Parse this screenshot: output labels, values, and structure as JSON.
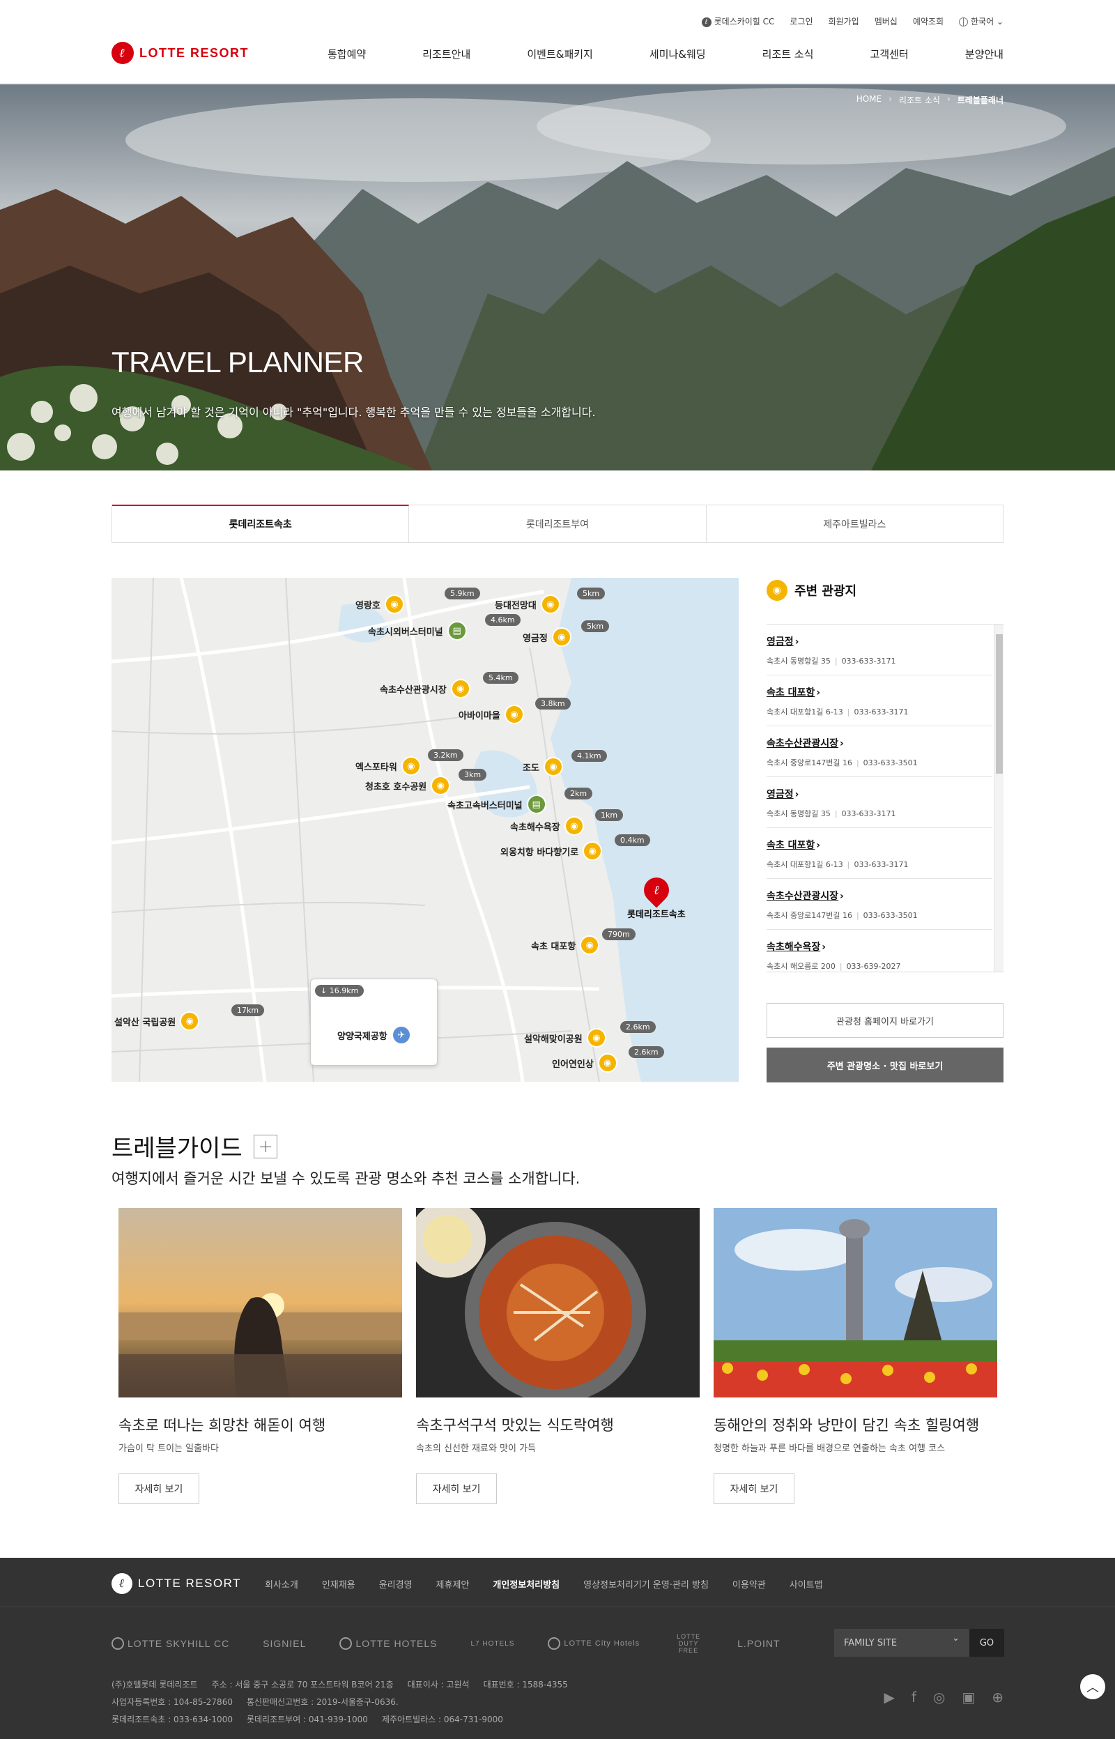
{
  "header": {
    "logo_text": "LOTTE RESORT",
    "util": {
      "skyhill": "롯데스카이힐 CC",
      "login": "로그인",
      "join": "회원가입",
      "membership": "멤버십",
      "reservation": "예약조회",
      "language": "한국어"
    },
    "nav": [
      "통합예약",
      "리조트안내",
      "이벤트&패키지",
      "세미나&웨딩",
      "리조트 소식",
      "고객센터",
      "분양안내"
    ]
  },
  "hero": {
    "breadcrumb": [
      "HOME",
      "리조트 소식",
      "트레블플래너"
    ],
    "title": "TRAVEL PLANNER",
    "subtitle": "여행에서 남겨야 할 것은 기억이 아니라 \"추억\"입니다. 행복한 추억을 만들 수 있는 정보들을 소개합니다."
  },
  "tabs": [
    "롯데리조트속초",
    "롯데리조트부여",
    "제주아트빌라스"
  ],
  "map": {
    "resort_label": "롯데리조트속초",
    "pois": [
      {
        "name": "영랑호",
        "dist": "5.9km",
        "type": "camera"
      },
      {
        "name": "등대전망대",
        "dist": "5km",
        "type": "camera"
      },
      {
        "name": "속초시외버스터미널",
        "dist": "4.6km",
        "type": "bus"
      },
      {
        "name": "영금정",
        "dist": "5km",
        "type": "camera"
      },
      {
        "name": "속초수산관광시장",
        "dist": "5.4km",
        "type": "camera"
      },
      {
        "name": "아바이마을",
        "dist": "3.8km",
        "type": "camera"
      },
      {
        "name": "엑스포타워",
        "dist": "3.2km",
        "type": "camera"
      },
      {
        "name": "조도",
        "dist": "4.1km",
        "type": "camera"
      },
      {
        "name": "청초호 호수공원",
        "dist": "3km",
        "type": "camera"
      },
      {
        "name": "속초고속버스터미널",
        "dist": "2km",
        "type": "bus"
      },
      {
        "name": "속초해수욕장",
        "dist": "1km",
        "type": "camera"
      },
      {
        "name": "외옹치항 바다향기로",
        "dist": "0.4km",
        "type": "camera"
      },
      {
        "name": "속초 대포항",
        "dist": "790m",
        "type": "camera"
      },
      {
        "name": "설악산 국립공원",
        "dist": "17km",
        "type": "camera"
      },
      {
        "name": "양양국제공항",
        "dist": "↓ 16.9km",
        "type": "airport"
      },
      {
        "name": "설악해맞이공원",
        "dist": "2.6km",
        "type": "camera"
      },
      {
        "name": "인어연인상",
        "dist": "2.6km",
        "type": "camera"
      }
    ]
  },
  "side": {
    "title": "주변 관광지",
    "items": [
      {
        "name": "영금정",
        "addr": "속초시 동명항길 35",
        "tel": "033-633-3171"
      },
      {
        "name": "속초 대포항",
        "addr": "속초시 대포항1길 6-13",
        "tel": "033-633-3171"
      },
      {
        "name": "속초수산관광시장",
        "addr": "속초시 중앙로147번길 16",
        "tel": "033-633-3501"
      },
      {
        "name": "영금정",
        "addr": "속초시 동명항길 35",
        "tel": "033-633-3171"
      },
      {
        "name": "속초 대포항",
        "addr": "속초시 대포항1길 6-13",
        "tel": "033-633-3171"
      },
      {
        "name": "속초수산관광시장",
        "addr": "속초시 중앙로147번길 16",
        "tel": "033-633-3501"
      },
      {
        "name": "속초해수욕장",
        "addr": "속초시 해오름로 200",
        "tel": "033-639-2027"
      }
    ],
    "btn_tourism": "관광청 홈페이지 바로가기",
    "btn_nearby": "주변 관광명소 · 맛집 바로보기"
  },
  "guide": {
    "title": "트레블가이드",
    "subtitle": "여행지에서 즐거운 시간 보낼 수 있도록 관광 명소와 추천 코스를 소개합니다.",
    "cards": [
      {
        "title": "속초로 떠나는 희망찬 해돋이 여행",
        "desc": "가슴이 탁 트이는 일출바다",
        "btn": "자세히 보기"
      },
      {
        "title": "속초구석구석 맛있는 식도락여행",
        "desc": "속초의 신선한 재료와 맛이 가득",
        "btn": "자세히 보기"
      },
      {
        "title": "동해안의 정취와 낭만이 담긴 속초 힐링여행",
        "desc": "청명한 하늘과 푸른 바다를 배경으로 연출하는 속초 여행 코스",
        "btn": "자세히 보기"
      }
    ]
  },
  "footer": {
    "logo_text": "LOTTE RESORT",
    "nav": [
      "회사소개",
      "인재채용",
      "윤리경영",
      "제휴제안",
      "개인정보처리방침",
      "영상정보처리기기 운영·관리 방침",
      "이용약관",
      "사이트맵"
    ],
    "brands": [
      "LOTTE SKYHILL CC",
      "SIGNIEL",
      "LOTTE HOTELS",
      "L7 HOTELS",
      "LOTTE City Hotels",
      "LOTTE DUTY FREE",
      "L.POINT"
    ],
    "family_site": "FAMILY SITE",
    "go": "GO",
    "info_line1": [
      "(주)호텔롯데 롯데리조트",
      "주소 : 서울 중구 소공로 70 포스트타워 B코어 21층",
      "대표이사 : 고원석",
      "대표번호 : 1588-4355"
    ],
    "info_line2": [
      "사업자등록번호 : 104-85-27860",
      "통신판매신고번호 : 2019-서울중구-0636."
    ],
    "info_line3": [
      "롯데리조트속초 : 033-634-1000",
      "롯데리조트부여 : 041-939-1000",
      "제주아트빌라스 : 064-731-9000"
    ]
  }
}
